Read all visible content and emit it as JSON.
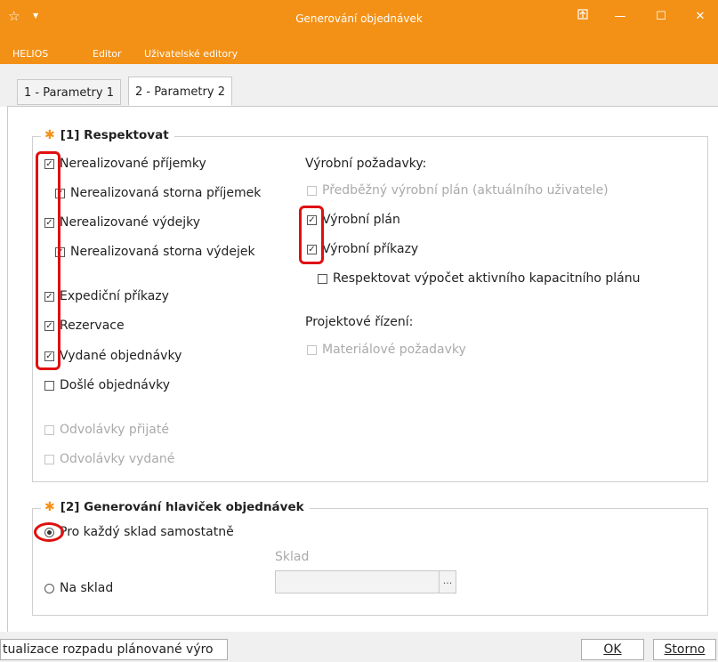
{
  "window": {
    "title": "Generování objednávek",
    "app_icon": "star-outline-icon",
    "controls": [
      "pin-window-icon",
      "minimize-icon",
      "maximize-icon",
      "close-icon"
    ]
  },
  "menu": [
    "HELIOS",
    "Editor",
    "Uživatelské editory"
  ],
  "tabs": [
    {
      "label": "1 - Parametry 1",
      "active": false
    },
    {
      "label": "2 - Parametry 2",
      "active": true
    }
  ],
  "group1": {
    "title": "[1] Respektovat",
    "left_checkboxes": [
      {
        "label": "Nerealizované příjemky",
        "checked": true,
        "enabled": true
      },
      {
        "label": "Nerealizovaná storna příjemek",
        "checked": true,
        "enabled": true
      },
      {
        "label": "Nerealizované výdejky",
        "checked": true,
        "enabled": true
      },
      {
        "label": "Nerealizovaná storna výdejek",
        "checked": true,
        "enabled": true
      },
      {
        "label": "Expediční příkazy",
        "checked": true,
        "enabled": true
      },
      {
        "label": "Rezervace",
        "checked": true,
        "enabled": true
      },
      {
        "label": "Vydané objednávky",
        "checked": true,
        "enabled": true
      },
      {
        "label": "Došlé objednávky",
        "checked": false,
        "enabled": true
      },
      {
        "label": "Odvolávky přijaté",
        "checked": false,
        "enabled": false
      },
      {
        "label": "Odvolávky vydané",
        "checked": false,
        "enabled": false
      }
    ],
    "production_label": "Výrobní požadavky:",
    "production_checkboxes": [
      {
        "label": "Předběžný výrobní plán (aktuálního uživatele)",
        "checked": false,
        "enabled": false
      },
      {
        "label": "Výrobní plán",
        "checked": true,
        "enabled": true
      },
      {
        "label": "Výrobní příkazy",
        "checked": true,
        "enabled": true
      },
      {
        "label": "Respektovat výpočet aktivního kapacitního plánu",
        "checked": false,
        "enabled": true
      }
    ],
    "project_label": "Projektové řízení:",
    "project_checkboxes": [
      {
        "label": "Materiálové požadavky",
        "checked": false,
        "enabled": false
      }
    ]
  },
  "group2": {
    "title": "[2] Generování hlaviček objednávek",
    "radios": [
      {
        "label": "Pro každý sklad samostatně",
        "selected": true
      },
      {
        "label": "Na sklad",
        "selected": false
      }
    ],
    "sklad_label": "Sklad",
    "sklad_value": "",
    "sklad_button": "..."
  },
  "footer": {
    "left_button": "tualizace rozpadu plánované výro",
    "ok": "OK",
    "cancel": "Storno"
  },
  "colors": {
    "accent": "#f39117",
    "annotation": "#e01010"
  }
}
